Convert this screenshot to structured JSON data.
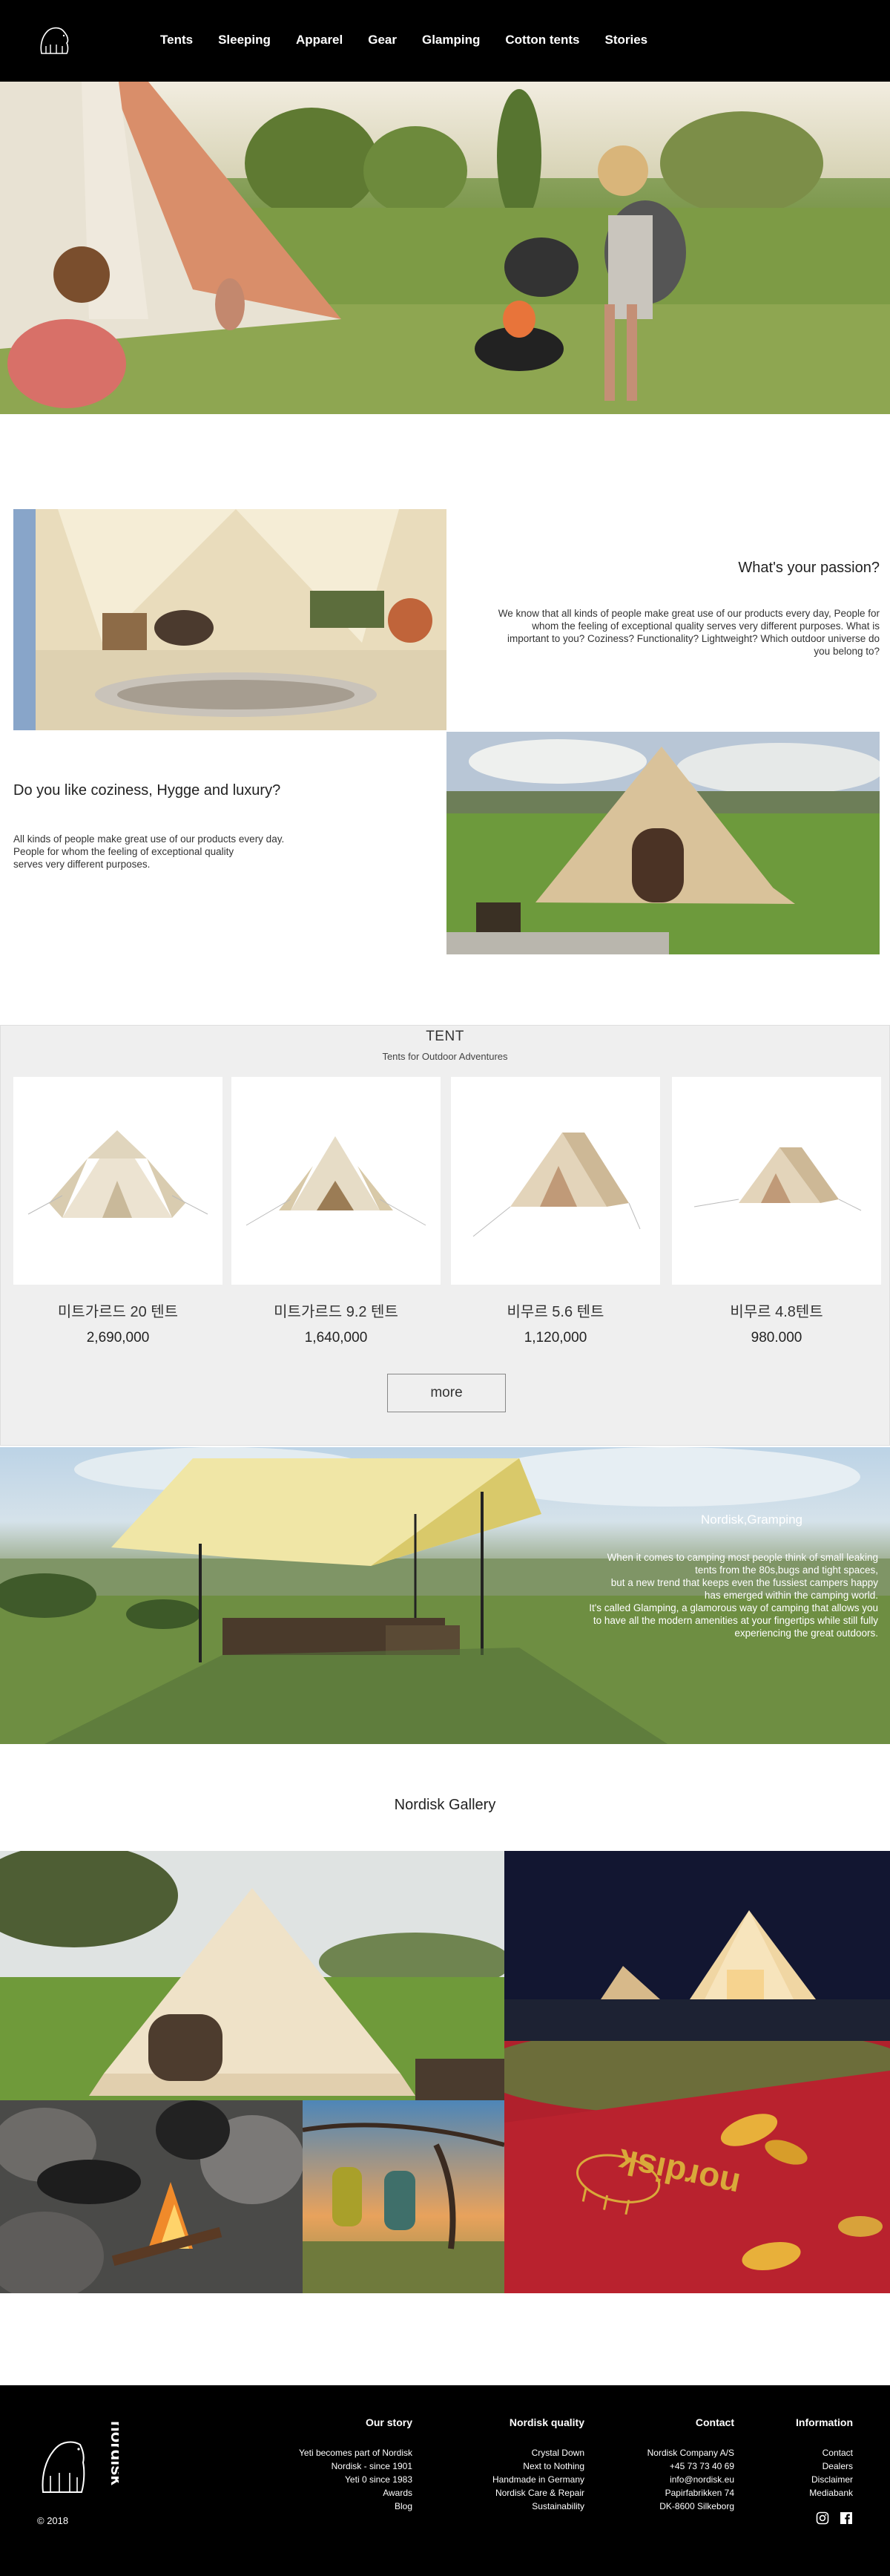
{
  "nav": {
    "items": [
      "Tents",
      "Sleeping",
      "Apparel",
      "Gear",
      "Glamping",
      "Cotton tents",
      "Stories"
    ]
  },
  "passion": {
    "title": "What's your passion?",
    "text": "We know that all kinds of people make great use of our products every day, People for whom the feeling of exceptional quality serves very different purposes. What is important to you? Coziness? Functionality? Lightweight? Which outdoor universe do you belong to?"
  },
  "coziness": {
    "title": "Do you like coziness, Hygge and luxury?",
    "text_lines": [
      "All kinds of people make great use of our products every day.",
      "People for whom the feeling of exceptional quality",
      "serves very different purposes."
    ]
  },
  "tents": {
    "title": "TENT",
    "subtitle": "Tents for Outdoor Adventures",
    "products": [
      {
        "name": "미트가르드 20 텐트",
        "price": "2,690,000"
      },
      {
        "name": "미트가르드 9.2 텐트",
        "price": "1,640,000"
      },
      {
        "name": "비무르 5.6 텐트",
        "price": "1,120,000"
      },
      {
        "name": "비무르 4.8텐트",
        "price": "980.000"
      }
    ],
    "more_label": "more"
  },
  "glamping": {
    "title": "Nordisk,Gramping",
    "text_lines": [
      "When it comes to camping most people think of small leaking",
      "tents from the 80s,bugs and tight spaces,",
      "but a new trend that keeps even the fussiest campers happy",
      "has emerged within the camping world.",
      "It's called Glamping, a glamorous way of camping that allows you",
      "to have all the modern amenities at your fingertips while still fully",
      "experiencing the great outdoors."
    ]
  },
  "gallery": {
    "title": "Nordisk Gallery",
    "logo_text": "nordisk"
  },
  "footer": {
    "brand": "nordisk",
    "copyright": "© 2018",
    "columns": [
      {
        "heading": "Our story",
        "lines": [
          "Yeti becomes part of Nordisk",
          "Nordisk - since 1901",
          "Yeti 0 since 1983",
          "Awards",
          "Blog"
        ]
      },
      {
        "heading": "Nordisk quality",
        "lines": [
          "Crystal Down",
          "Next to Nothing",
          "Handmade in Germany",
          "Nordisk Care & Repair",
          "Sustainability"
        ]
      },
      {
        "heading": "Contact",
        "lines": [
          "Nordisk Company A/S",
          "+45 73 73 40 69",
          "info@nordisk.eu",
          "Papirfabrikken 74",
          "DK-8600 Silkeborg"
        ]
      },
      {
        "heading": "Information",
        "lines": [
          "Contact",
          "Dealers",
          "Disclaimer",
          "Mediabank"
        ]
      }
    ],
    "social": [
      "instagram-icon",
      "facebook-icon"
    ]
  },
  "colors": {
    "header_bg": "#000000",
    "footer_bg": "#000000",
    "section_bg": "#efefef",
    "gallery_red": "#b0202c",
    "gallery_gold": "#d9a93a"
  }
}
